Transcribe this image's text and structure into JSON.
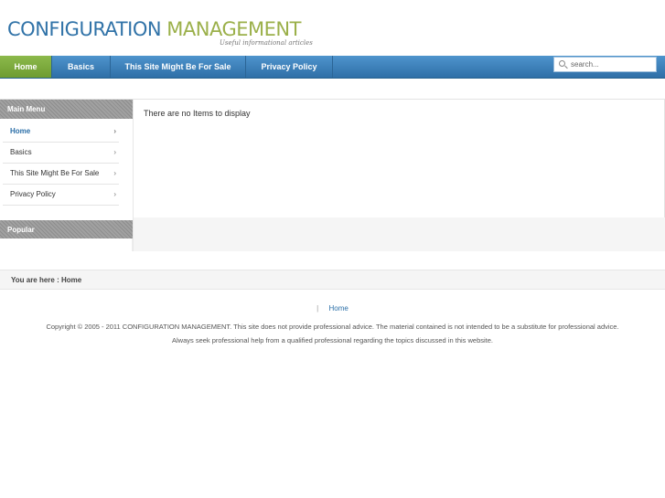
{
  "header": {
    "logo_word1": "CONFIGURATION",
    "logo_word2": "MANAGEMENT",
    "tagline": "Useful informational articles"
  },
  "nav": {
    "items": [
      {
        "label": "Home",
        "active": true
      },
      {
        "label": "Basics"
      },
      {
        "label": "This Site Might Be For Sale"
      },
      {
        "label": "Privacy Policy"
      }
    ],
    "search_placeholder": "search..."
  },
  "sidebar": {
    "main_menu_title": "Main Menu",
    "items": [
      {
        "label": "Home",
        "arrow": "›"
      },
      {
        "label": "Basics",
        "arrow": "›"
      },
      {
        "label": "This Site Might Be For Sale",
        "arrow": "›"
      },
      {
        "label": "Privacy Policy",
        "arrow": "›"
      }
    ],
    "popular_title": "Popular"
  },
  "main": {
    "message": "There are no Items to display"
  },
  "breadcrumb": {
    "text": "You are here  :  Home"
  },
  "footer": {
    "separator": "|",
    "link_home": "Home",
    "copyright_line1": "Copyright © 2005 - 2011 CONFIGURATION MANAGEMENT. This site does not provide professional advice. The material contained is not intended to be a substitute for professional advice.",
    "copyright_line2": "Always seek professional help from a qualified professional regarding the topics discussed in this website."
  },
  "colors": {
    "brand_blue": "#3173a8",
    "brand_green": "#9bb04a",
    "nav_blue": "#2f6fa7",
    "nav_active_green": "#7fab3f"
  }
}
